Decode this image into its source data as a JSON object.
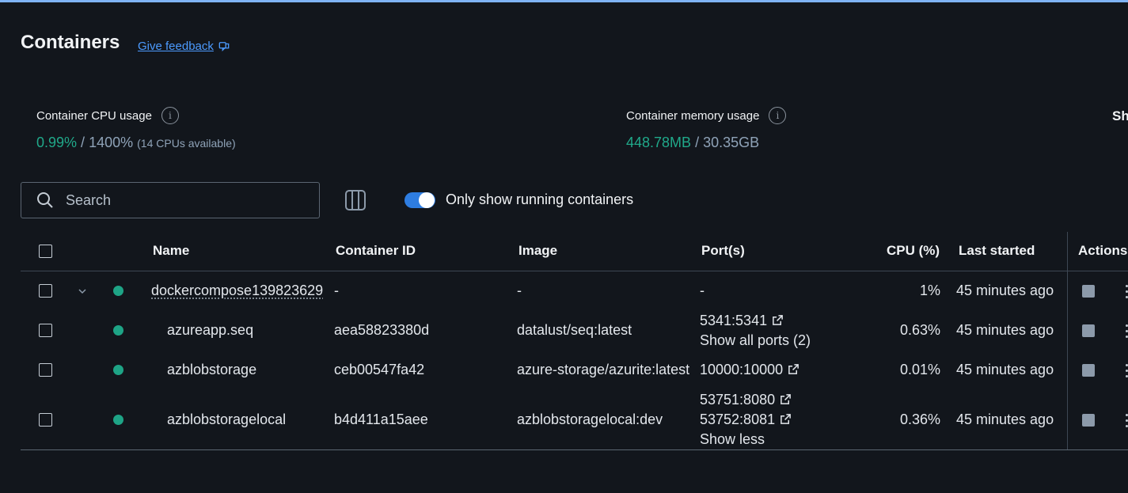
{
  "page": {
    "title": "Containers",
    "feedback_label": "Give feedback"
  },
  "stats": {
    "cpu": {
      "label": "Container CPU usage",
      "used": "0.99%",
      "separator": " / ",
      "total": "1400%",
      "note": "(14 CPUs available)"
    },
    "memory": {
      "label": "Container memory usage",
      "used": "448.78MB",
      "separator": " / ",
      "total": "30.35GB"
    },
    "cut_label": "Sh"
  },
  "toolbar": {
    "search_placeholder": "Search",
    "toggle_label": "Only show running containers",
    "toggle_on": true
  },
  "table": {
    "headers": {
      "name": "Name",
      "container_id": "Container ID",
      "image": "Image",
      "ports": "Port(s)",
      "cpu": "CPU (%)",
      "last_started": "Last started",
      "actions": "Actions"
    },
    "rows": [
      {
        "name": "dockercompose139823629",
        "container_id": "-",
        "image": "-",
        "ports": [
          "-"
        ],
        "ports_link": "",
        "cpu": "1%",
        "last_started": "45 minutes ago",
        "status_color": "#1ea486"
      },
      {
        "name": "azureapp.seq",
        "container_id": "aea58823380d",
        "image": "datalust/seq:latest",
        "ports": [
          "5341:5341"
        ],
        "ports_link": "Show all ports (2)",
        "cpu": "0.63%",
        "last_started": "45 minutes ago",
        "status_color": "#1ea486"
      },
      {
        "name": "azblobstorage",
        "container_id": "ceb00547fa42",
        "image": "azure-storage/azurite:latest",
        "ports": [
          "10000:10000"
        ],
        "ports_link": "",
        "cpu": "0.01%",
        "last_started": "45 minutes ago",
        "status_color": "#1ea486"
      },
      {
        "name": "azblobstoragelocal",
        "container_id": "b4d411a15aee",
        "image": "azblobstoragelocal:dev",
        "ports": [
          "53751:8080",
          "53752:8081"
        ],
        "ports_link": "Show less",
        "cpu": "0.36%",
        "last_started": "45 minutes ago",
        "status_color": "#1ea486"
      }
    ]
  },
  "colors": {
    "background": "#12161c",
    "accent": "#2e7de1",
    "link": "#4c9bff",
    "running": "#1ea486"
  }
}
